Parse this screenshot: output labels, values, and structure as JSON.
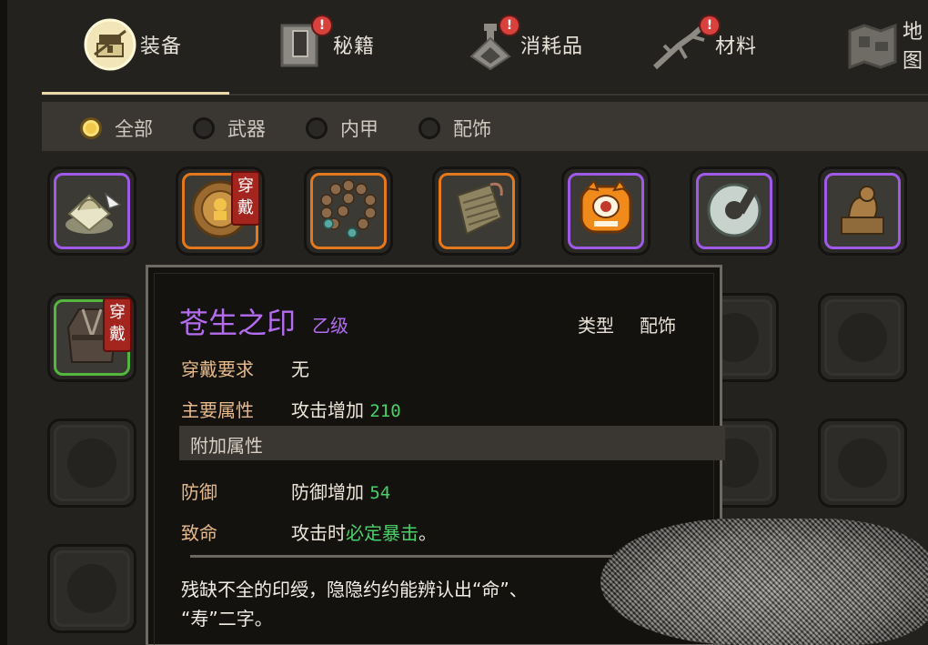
{
  "tabs": [
    {
      "label": "装备",
      "icon": "equipment-icon",
      "active": true,
      "badge": ""
    },
    {
      "label": "秘籍",
      "icon": "book-icon",
      "active": false,
      "badge": "!"
    },
    {
      "label": "消耗品",
      "icon": "potion-icon",
      "active": false,
      "badge": "!"
    },
    {
      "label": "材料",
      "icon": "herb-icon",
      "active": false,
      "badge": "!"
    },
    {
      "label": "地图",
      "icon": "map-icon",
      "active": false,
      "badge": ""
    }
  ],
  "filters": [
    {
      "label": "全部",
      "selected": true
    },
    {
      "label": "武器",
      "selected": false
    },
    {
      "label": "内甲",
      "selected": false
    },
    {
      "label": "配饰",
      "selected": false
    }
  ],
  "wear_badge": "穿戴",
  "items_row1": [
    {
      "icon": "jade-seal-icon",
      "rarity": "purple",
      "worn": false
    },
    {
      "icon": "golden-medallion-icon",
      "rarity": "orange",
      "worn": true
    },
    {
      "icon": "prayer-beads-icon",
      "rarity": "orange",
      "worn": false
    },
    {
      "icon": "cloth-armor-icon",
      "rarity": "orange",
      "worn": false
    },
    {
      "icon": "orange-eye-creature-icon",
      "rarity": "purple",
      "worn": false
    },
    {
      "icon": "jade-ring-icon",
      "rarity": "purple",
      "worn": false
    },
    {
      "icon": "bronze-seal-icon",
      "rarity": "purple",
      "worn": false
    }
  ],
  "items_row2": [
    {
      "icon": "dark-robe-icon",
      "rarity": "green",
      "worn": true
    }
  ],
  "tooltip": {
    "name": "苍生之印",
    "grade": "乙级",
    "type_label": "类型",
    "type_value": "配饰",
    "requirement_label": "穿戴要求",
    "requirement_value": "无",
    "main_attr_label": "主要属性",
    "main_attr_text": "攻击增加",
    "main_attr_value": "210",
    "extra_section": "附加属性",
    "defense_label": "防御",
    "defense_text": "防御增加",
    "defense_value": "54",
    "crit_label": "致命",
    "crit_prefix": "攻击时",
    "crit_highlight": "必定暴击",
    "crit_suffix": "。",
    "description_line1": "残缺不全的印绶，隐隐约约能辨认出“命”、",
    "description_line2": "“寿”二字。"
  },
  "colors": {
    "purple": "#a05ae8",
    "orange": "#e3781d",
    "green": "#53b63d",
    "badge_red": "#d8413c",
    "highlight_green": "#49d168"
  }
}
